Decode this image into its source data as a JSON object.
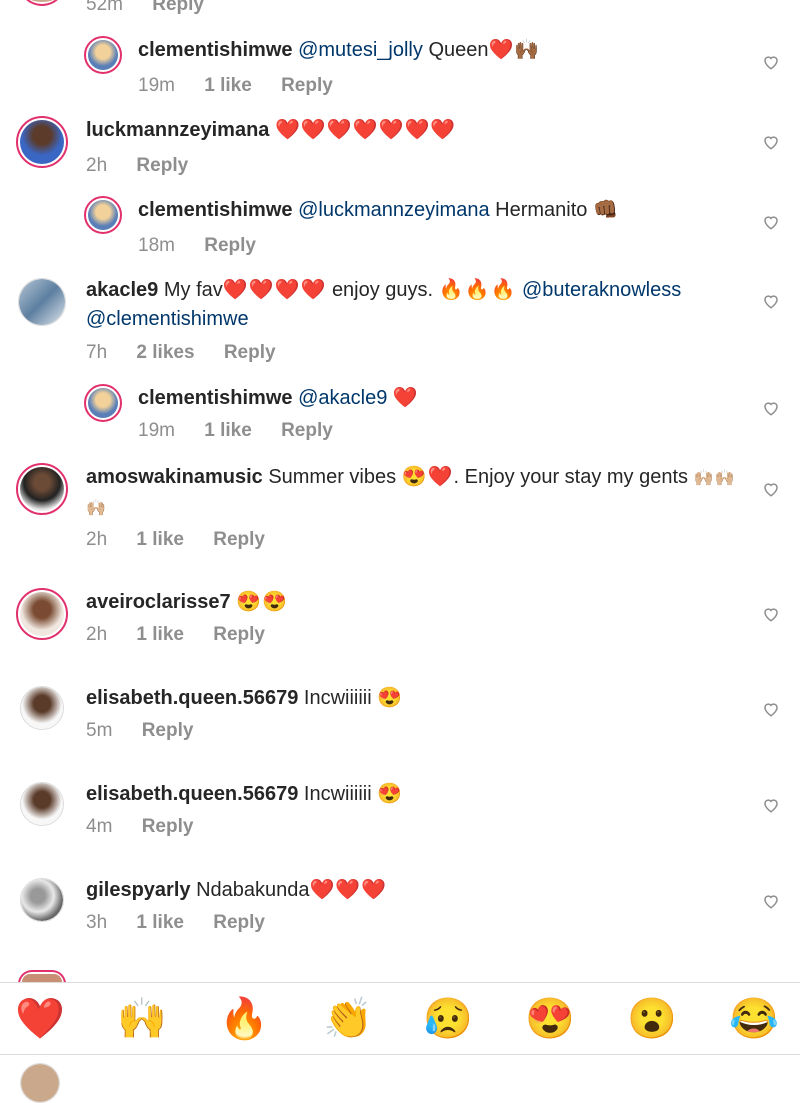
{
  "top_partial": {
    "time": "52m",
    "reply": "Reply"
  },
  "comments": [
    {
      "user": "clementishimwe",
      "mention": "@mutesi_jolly",
      "text": "Queen",
      "emoji": "❤️🙌🏾",
      "time": "19m",
      "likes": "1 like",
      "reply": "Reply",
      "reply_level": 1
    },
    {
      "user": "luckmannzeyimana",
      "text": "",
      "emoji": "❤️❤️❤️❤️❤️❤️❤️",
      "time": "2h",
      "likes": "",
      "reply": "Reply",
      "reply_level": 0
    },
    {
      "user": "clementishimwe",
      "mention": "@luckmannzeyimana",
      "text": "Hermanito",
      "emoji": "👊🏾",
      "time": "18m",
      "likes": "",
      "reply": "Reply",
      "reply_level": 1
    },
    {
      "user": "akacle9",
      "text": "My fav",
      "emoji": "❤️❤️❤️❤️",
      "text2": "enjoy guys.",
      "emoji2": "🔥🔥🔥",
      "mention": "@buteraknowless",
      "mention2": "@clementishimwe",
      "time": "7h",
      "likes": "2 likes",
      "reply": "Reply",
      "reply_level": 0
    },
    {
      "user": "clementishimwe",
      "mention": "@akacle9",
      "text": "",
      "emoji": "❤️",
      "time": "19m",
      "likes": "1 like",
      "reply": "Reply",
      "reply_level": 1
    },
    {
      "user": "amoswakinamusic",
      "text": "Summer vibes",
      "emoji": "😍❤️",
      "text2": ". Enjoy your stay my gents",
      "emoji2": "🙌🏼🙌🏼🙌🏼",
      "time": "2h",
      "likes": "1 like",
      "reply": "Reply",
      "reply_level": 0
    },
    {
      "user": "aveiroclarisse7",
      "text": "",
      "emoji": "😍😍",
      "time": "2h",
      "likes": "1 like",
      "reply": "Reply",
      "reply_level": 0
    },
    {
      "user": "elisabeth.queen.56679",
      "text": "Incwiiiiii",
      "emoji": "😍",
      "time": "5m",
      "likes": "",
      "reply": "Reply",
      "reply_level": 0
    },
    {
      "user": "elisabeth.queen.56679",
      "text": "Incwiiiiii",
      "emoji": "😍",
      "time": "4m",
      "likes": "",
      "reply": "Reply",
      "reply_level": 0
    },
    {
      "user": "gilespyarly",
      "text": "Ndabakunda",
      "emoji": "❤️❤️❤️",
      "time": "3h",
      "likes": "1 like",
      "reply": "Reply",
      "reply_level": 0
    }
  ],
  "reaction_bar": [
    "❤️",
    "🙌",
    "🔥",
    "👏",
    "😥",
    "😍",
    "😮",
    "😂"
  ],
  "icons": {
    "like": "heart-outline-icon"
  },
  "colors": {
    "mention": "#00376b",
    "meta": "#8e8e8e",
    "story_ring": "#e1306c"
  }
}
